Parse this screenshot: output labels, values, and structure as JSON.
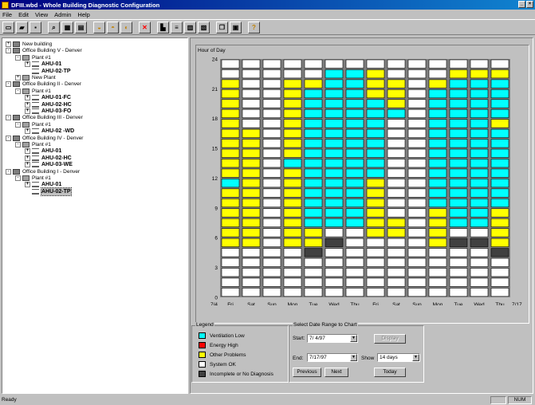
{
  "window": {
    "title": "DFIII.wbd - Whole Building Diagnostic Configuration"
  },
  "menu": [
    "File",
    "Edit",
    "View",
    "Admin",
    "Help"
  ],
  "toolbar": [
    "new-icon",
    "open-icon",
    "save-icon",
    "find-icon",
    "grid-icon",
    "table-icon",
    "wb1-icon",
    "wb2-icon",
    "wb3-icon",
    "delete-icon",
    "building-icon",
    "list-icon",
    "chart-icon",
    "report-icon",
    "cascade-icon",
    "tile-icon",
    "help-icon"
  ],
  "tree": [
    {
      "label": "New building",
      "level": 0,
      "kind": "bld",
      "exp": "+"
    },
    {
      "label": "Office Building V - Denver",
      "level": 0,
      "kind": "bld",
      "exp": "-"
    },
    {
      "label": "Plant #1",
      "level": 1,
      "kind": "plant",
      "exp": "-"
    },
    {
      "label": "AHU-01",
      "level": 2,
      "kind": "ahu",
      "exp": "+"
    },
    {
      "label": "AHU-02-TP",
      "level": 2,
      "kind": "ahu",
      "exp": ""
    },
    {
      "label": "New Plant",
      "level": 1,
      "kind": "plant",
      "exp": "+"
    },
    {
      "label": "Office Building II - Denver",
      "level": 0,
      "kind": "bld",
      "exp": "-"
    },
    {
      "label": "Plant #1",
      "level": 1,
      "kind": "plant",
      "exp": "-"
    },
    {
      "label": "AHU-01-FC",
      "level": 2,
      "kind": "ahu",
      "exp": "+"
    },
    {
      "label": "AHU-02-HC",
      "level": 2,
      "kind": "ahu",
      "exp": "+"
    },
    {
      "label": "AHU-03-FO",
      "level": 2,
      "kind": "ahu",
      "exp": "+"
    },
    {
      "label": "Office Building III - Denver",
      "level": 0,
      "kind": "bld",
      "exp": "-"
    },
    {
      "label": "Plant #1",
      "level": 1,
      "kind": "plant",
      "exp": "-"
    },
    {
      "label": "AHU-02 -WD",
      "level": 2,
      "kind": "ahu",
      "exp": "+"
    },
    {
      "label": "Office Building IV - Denver",
      "level": 0,
      "kind": "bld",
      "exp": "-"
    },
    {
      "label": "Plant #1",
      "level": 1,
      "kind": "plant",
      "exp": "-"
    },
    {
      "label": "AHU-01",
      "level": 2,
      "kind": "ahu",
      "exp": "+"
    },
    {
      "label": "AHU-02-HC",
      "level": 2,
      "kind": "ahu",
      "exp": "+"
    },
    {
      "label": "AHU-03-WE",
      "level": 2,
      "kind": "ahu",
      "exp": "+"
    },
    {
      "label": "Office Building I - Denver",
      "level": 0,
      "kind": "bld",
      "exp": "-"
    },
    {
      "label": "Plant #1",
      "level": 1,
      "kind": "plant",
      "exp": "-"
    },
    {
      "label": "AHU-01",
      "level": 2,
      "kind": "ahu",
      "exp": "+"
    },
    {
      "label": "AHU-02-TP",
      "level": 2,
      "kind": "ahu",
      "exp": "",
      "selected": true
    }
  ],
  "chart_data": {
    "type": "heatmap",
    "title": "",
    "ylabel": "Hour of Day",
    "ylim": [
      0,
      24
    ],
    "yticks": [
      0,
      3,
      6,
      9,
      12,
      15,
      18,
      21,
      24
    ],
    "x_edge_labels": [
      "7/4",
      "7/17"
    ],
    "categories": [
      "Fri",
      "Sat",
      "Sun",
      "Mon",
      "Tue",
      "Wed",
      "Thu",
      "Fri",
      "Sat",
      "Sun",
      "Mon",
      "Tue",
      "Wed",
      "Thu"
    ],
    "colors": {
      "C": "#00ffff",
      "Y": "#ffff00",
      "W": "#ffffff",
      "D": "#404040",
      "R": "#ff0000",
      "border": "#000000",
      "bg": "#808080"
    },
    "cells_note": "rows from hour 0 at bottom to hour 23 at top; one string per day; C=Ventilation Low, R=Energy High, Y=Other Problems, W=System OK, D=Incomplete or No Diagnosis",
    "cells": [
      "WWWWWYYYYYYCYYYYYYYYYYWW",
      "WWWWWYYYYYYYYYYYYWWWWWWW",
      "WWWWWWWWWWWWWWWWWWWWWWWW",
      "WWWWWYYYYYYYYCYYYYYYYYWW",
      "WWWWDYYCCCCCCCCCCCCCCYWW",
      "WWWWWDWCCCCCCCCCCCCCCCCW",
      "WWWWWWWCCCCCCCCCCCCCCCCW",
      "WWWWWWYYYYYYCCCCCCCCYYYW",
      "WWWWWWYYWWWWWWWWWWCYYYWW",
      "WWWWWWWWWWWWWWWWWWWWWWWW",
      "WWWWWYYYYCCCCCCCCCCCCYWW",
      "WWWWWDWCCCCCCCCCCCCCCCYW",
      "WWWWWDWCCCCCCCCCCCCCCCYW",
      "WWWWDYYYYCCCCCCCCYCCCCYW"
    ]
  },
  "legend": {
    "title": "Legend",
    "items": [
      {
        "label": "Ventilation Low",
        "color": "#00ffff"
      },
      {
        "label": "Energy High",
        "color": "#ff0000"
      },
      {
        "label": "Other Problems",
        "color": "#ffff00"
      },
      {
        "label": "System OK",
        "color": "#ffffff"
      },
      {
        "label": "Incomplete or No Diagnosis",
        "color": "#404040"
      }
    ]
  },
  "range": {
    "title": "Select Date Range to Chart",
    "start_label": "Start:",
    "start_value": "7/ 4/97",
    "end_label": "End:",
    "end_value": "7/17/97",
    "show_label": "Show",
    "show_value": "14 days",
    "display_btn": "Display",
    "prev_btn": "Previous",
    "next_btn": "Next",
    "today_btn": "Today"
  },
  "status": {
    "text": "Ready",
    "num": "NUM"
  }
}
